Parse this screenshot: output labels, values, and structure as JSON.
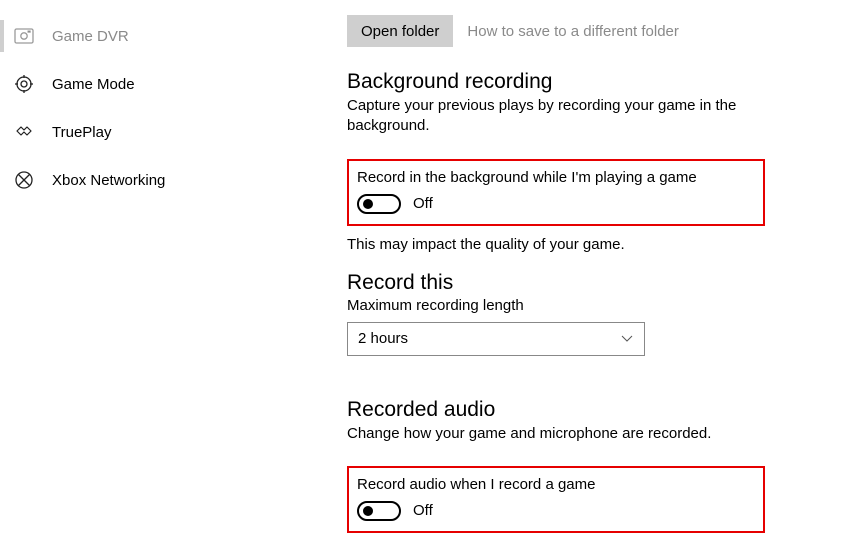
{
  "sidebar": {
    "items": [
      {
        "label": "Game DVR",
        "active": true
      },
      {
        "label": "Game Mode"
      },
      {
        "label": "TruePlay"
      },
      {
        "label": "Xbox Networking"
      }
    ]
  },
  "topbar": {
    "open_folder": "Open folder",
    "how_to_save": "How to save to a different folder"
  },
  "background_recording": {
    "title": "Background recording",
    "desc": "Capture your previous plays by recording your game in the background.",
    "setting_label": "Record in the background while I'm playing a game",
    "state": "Off",
    "note": "This may impact the quality of your game."
  },
  "record_this": {
    "title": "Record this",
    "subtitle": "Maximum recording length",
    "selected": "2 hours"
  },
  "recorded_audio": {
    "title": "Recorded audio",
    "desc": "Change how your game and microphone are recorded.",
    "setting_label": "Record audio when I record a game",
    "state": "Off"
  }
}
